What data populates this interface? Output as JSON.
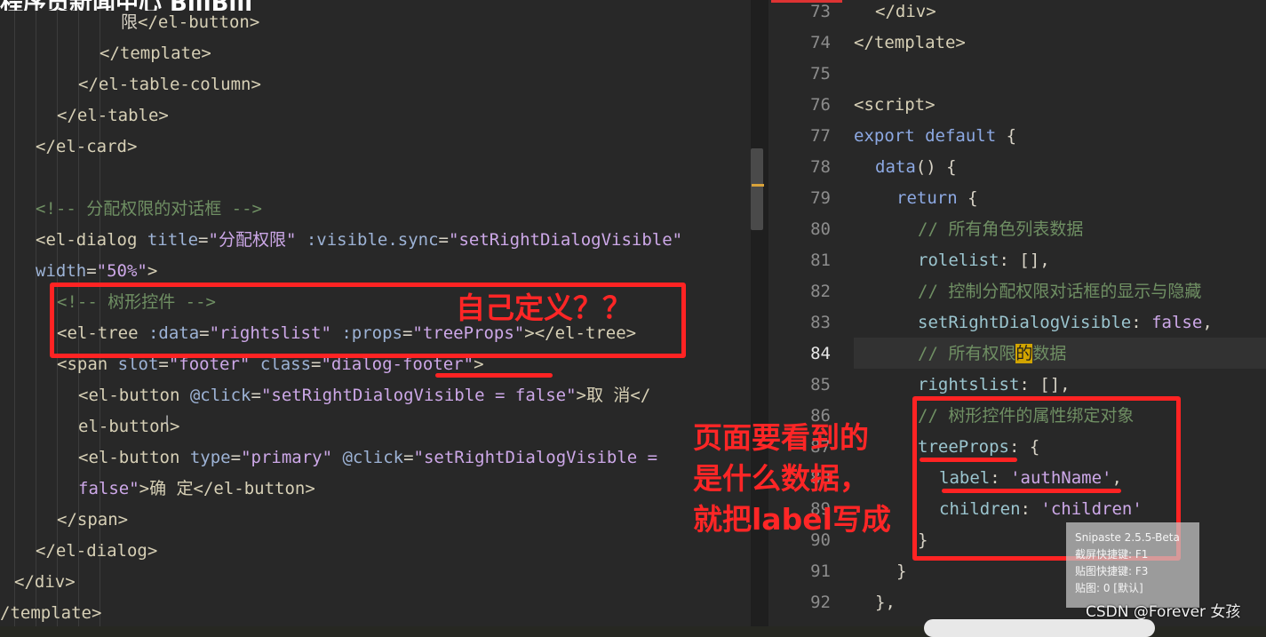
{
  "overlay": {
    "banner_text": "程序员新闻中心 BiliBili",
    "annotation_self_defined": "自己定义？？",
    "annotation_explain_lines": [
      "页面要看到的",
      "是什么数据，",
      "就把label写成"
    ],
    "snipaste_lines": [
      "Snipaste 2.5.5-Beta",
      "截屏快捷键: F1",
      "贴图快捷键: F3",
      "贴图: 0 [默认]"
    ],
    "watermark": "CSDN @Forever  女孩",
    "colors": {
      "annotation": "#ff2323",
      "cursor_highlight": "#d1a400"
    }
  },
  "left_code": [
    [
      {
        "t": "限",
        "c": "punc"
      },
      {
        "t": "</el-button>",
        "c": "tag"
      }
    ],
    [
      {
        "t": "</template>",
        "c": "tag"
      }
    ],
    [
      {
        "t": "</el-table-column>",
        "c": "tag"
      }
    ],
    [
      {
        "t": "</el-table>",
        "c": "tag"
      }
    ],
    [
      {
        "t": "</el-card>",
        "c": "tag"
      }
    ],
    [],
    [
      {
        "t": "<!-- 分配权限的对话框 -->",
        "c": "cmt"
      }
    ],
    [
      {
        "t": "<el-dialog ",
        "c": "tag"
      },
      {
        "t": "title",
        "c": "attr"
      },
      {
        "t": "=",
        "c": "punc"
      },
      {
        "t": "\"分配权限\"",
        "c": "str"
      },
      {
        "t": " :visible.sync",
        "c": "attr"
      },
      {
        "t": "=",
        "c": "punc"
      },
      {
        "t": "\"setRightDialogVisible\"",
        "c": "str"
      }
    ],
    [
      {
        "t": "width",
        "c": "attr"
      },
      {
        "t": "=",
        "c": "punc"
      },
      {
        "t": "\"50%\"",
        "c": "str"
      },
      {
        "t": ">",
        "c": "tag"
      }
    ],
    [
      {
        "t": "<!-- 树形控件 -->",
        "c": "cmt"
      }
    ],
    [
      {
        "t": "<el-tree ",
        "c": "tag"
      },
      {
        "t": ":data",
        "c": "attr"
      },
      {
        "t": "=",
        "c": "punc"
      },
      {
        "t": "\"rightslist\"",
        "c": "str"
      },
      {
        "t": " :props",
        "c": "attr"
      },
      {
        "t": "=",
        "c": "punc"
      },
      {
        "t": "\"treeProps\"",
        "c": "str"
      },
      {
        "t": "></el-tree>",
        "c": "tag"
      }
    ],
    [
      {
        "t": "<span ",
        "c": "tag"
      },
      {
        "t": "slot",
        "c": "attr"
      },
      {
        "t": "=",
        "c": "punc"
      },
      {
        "t": "\"footer\"",
        "c": "str"
      },
      {
        "t": " class",
        "c": "attr"
      },
      {
        "t": "=",
        "c": "punc"
      },
      {
        "t": "\"dialog-footer\"",
        "c": "str"
      },
      {
        "t": ">",
        "c": "tag"
      }
    ],
    [
      {
        "t": "<el-button ",
        "c": "tag"
      },
      {
        "t": "@click",
        "c": "attr"
      },
      {
        "t": "=",
        "c": "punc"
      },
      {
        "t": "\"setRightDialogVisible = false\"",
        "c": "str"
      },
      {
        "t": ">取 消</",
        "c": "tag"
      }
    ],
    [
      {
        "t": "el-button>",
        "c": "tag"
      }
    ],
    [
      {
        "t": "<el-button ",
        "c": "tag"
      },
      {
        "t": "type",
        "c": "attr"
      },
      {
        "t": "=",
        "c": "punc"
      },
      {
        "t": "\"primary\"",
        "c": "str"
      },
      {
        "t": " @click",
        "c": "attr"
      },
      {
        "t": "=",
        "c": "punc"
      },
      {
        "t": "\"setRightDialogVisible =",
        "c": "str"
      }
    ],
    [
      {
        "t": "false\"",
        "c": "str"
      },
      {
        "t": ">确 定</el-button>",
        "c": "tag"
      }
    ],
    [
      {
        "t": "</span>",
        "c": "tag"
      }
    ],
    [
      {
        "t": "</el-dialog>",
        "c": "tag"
      }
    ],
    [
      {
        "t": "</div>",
        "c": "tag"
      }
    ],
    [
      {
        "t": "/template>",
        "c": "tag"
      }
    ]
  ],
  "right_code": [
    {
      "n": "73",
      "tokens": [
        {
          "t": "</div>",
          "c": "tag"
        }
      ]
    },
    {
      "n": "74",
      "tokens": [
        {
          "t": "</template>",
          "c": "tag"
        }
      ]
    },
    {
      "n": "75",
      "tokens": []
    },
    {
      "n": "76",
      "tokens": [
        {
          "t": "<script>",
          "c": "tag"
        }
      ]
    },
    {
      "n": "77",
      "tokens": [
        {
          "t": "export default ",
          "c": "kw"
        },
        {
          "t": "{",
          "c": "punc"
        }
      ]
    },
    {
      "n": "78",
      "tokens": [
        {
          "t": "data",
          "c": "fn"
        },
        {
          "t": "() {",
          "c": "punc"
        }
      ]
    },
    {
      "n": "79",
      "tokens": [
        {
          "t": "return ",
          "c": "kw"
        },
        {
          "t": "{",
          "c": "punc"
        }
      ]
    },
    {
      "n": "80",
      "tokens": [
        {
          "t": "// 所有角色列表数据",
          "c": "cmt"
        }
      ]
    },
    {
      "n": "81",
      "tokens": [
        {
          "t": "rolelist",
          "c": "prop"
        },
        {
          "t": ": [],",
          "c": "punc"
        }
      ]
    },
    {
      "n": "82",
      "tokens": [
        {
          "t": "// 控制分配权限对话框的显示与隐藏",
          "c": "cmt"
        }
      ]
    },
    {
      "n": "83",
      "tokens": [
        {
          "t": "setRightDialogVisible",
          "c": "prop"
        },
        {
          "t": ": ",
          "c": "punc"
        },
        {
          "t": "false",
          "c": "bool"
        },
        {
          "t": ",",
          "c": "punc"
        }
      ]
    },
    {
      "n": "84",
      "tokens": [
        {
          "t": "// 所有权限",
          "c": "cmt"
        },
        {
          "t": "的",
          "c": "cursor"
        },
        {
          "t": "数据",
          "c": "cmt"
        }
      ]
    },
    {
      "n": "85",
      "tokens": [
        {
          "t": "rightslist",
          "c": "prop"
        },
        {
          "t": ": [],",
          "c": "punc"
        }
      ]
    },
    {
      "n": "86",
      "tokens": [
        {
          "t": "// 树形控件的属性绑定对象",
          "c": "cmt"
        }
      ]
    },
    {
      "n": "87",
      "tokens": [
        {
          "t": "treeProps",
          "c": "prop"
        },
        {
          "t": ": {",
          "c": "punc"
        }
      ]
    },
    {
      "n": "88",
      "tokens": [
        {
          "t": "label",
          "c": "prop"
        },
        {
          "t": ": ",
          "c": "punc"
        },
        {
          "t": "'authName'",
          "c": "str"
        },
        {
          "t": ",",
          "c": "punc"
        }
      ]
    },
    {
      "n": "89",
      "tokens": [
        {
          "t": "children",
          "c": "prop"
        },
        {
          "t": ": ",
          "c": "punc"
        },
        {
          "t": "'children'",
          "c": "str"
        }
      ]
    },
    {
      "n": "90",
      "tokens": [
        {
          "t": "}",
          "c": "punc"
        }
      ]
    },
    {
      "n": "91",
      "tokens": [
        {
          "t": "}",
          "c": "punc"
        }
      ]
    },
    {
      "n": "92",
      "tokens": [
        {
          "t": "},",
          "c": "punc"
        }
      ]
    }
  ]
}
